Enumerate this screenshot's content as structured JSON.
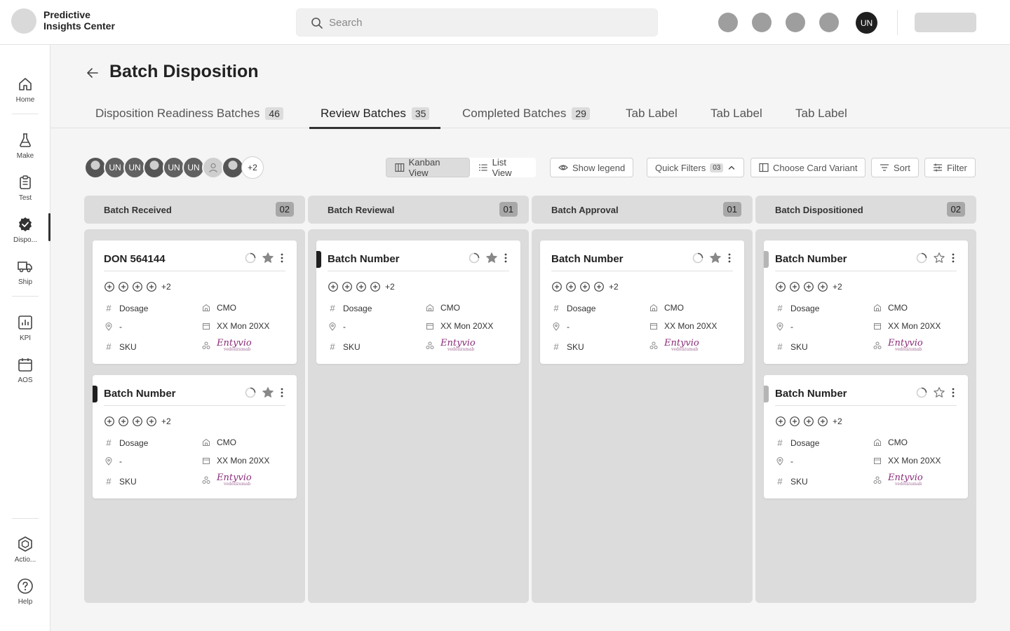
{
  "app": {
    "name_line1": "Predictive",
    "name_line2": "Insights Center"
  },
  "search": {
    "placeholder": "Search"
  },
  "header": {
    "user_initials": "UN"
  },
  "sidebar": {
    "items": [
      {
        "label": "Home",
        "icon": "home-icon"
      },
      {
        "label": "Make",
        "icon": "flask-icon"
      },
      {
        "label": "Test",
        "icon": "clipboard-icon"
      },
      {
        "label": "Dispo...",
        "icon": "badge-check-icon"
      },
      {
        "label": "Ship",
        "icon": "truck-icon"
      },
      {
        "label": "KPI",
        "icon": "chart-icon"
      },
      {
        "label": "AOS",
        "icon": "calendar-icon"
      }
    ],
    "bottom": [
      {
        "label": "Actio...",
        "icon": "cube-icon"
      },
      {
        "label": "Help",
        "icon": "help-icon"
      }
    ]
  },
  "page": {
    "title": "Batch Disposition"
  },
  "tabs": [
    {
      "label": "Disposition Readiness Batches",
      "count": "46"
    },
    {
      "label": "Review Batches",
      "count": "35"
    },
    {
      "label": "Completed Batches",
      "count": "29"
    },
    {
      "label": "Tab Label"
    },
    {
      "label": "Tab Label"
    },
    {
      "label": "Tab Label"
    }
  ],
  "toolbar": {
    "avatar_initials": "UN",
    "avatar_more": "+2",
    "kanban_view": "Kanban View",
    "list_view": "List View",
    "show_legend": "Show legend",
    "quick_filters": "Quick Filters",
    "quick_filters_count": "03",
    "choose_card_variant": "Choose Card Variant",
    "sort": "Sort",
    "filter": "Filter"
  },
  "card_fields": {
    "dosage": "Dosage",
    "cmo": "CMO",
    "location": "-",
    "date": "XX Mon 20XX",
    "sku": "SKU",
    "plus_more": "+2",
    "brand": "Entyvio",
    "brand_sub": "vedolizumab"
  },
  "columns": [
    {
      "name": "Batch Received",
      "count": "02",
      "cards": [
        {
          "title": "DON 564144"
        },
        {
          "title": "Batch Number"
        }
      ]
    },
    {
      "name": "Batch Reviewal",
      "count": "01",
      "cards": [
        {
          "title": "Batch Number"
        }
      ]
    },
    {
      "name": "Batch Approval",
      "count": "01",
      "cards": [
        {
          "title": "Batch Number"
        }
      ]
    },
    {
      "name": "Batch Dispositioned",
      "count": "02",
      "cards": [
        {
          "title": "Batch Number"
        },
        {
          "title": "Batch Number"
        }
      ]
    }
  ],
  "colors": {
    "stripe_dark": "#1f1f1f",
    "stripe_light": "#b5b5b5",
    "brand": "#8a2c78"
  }
}
